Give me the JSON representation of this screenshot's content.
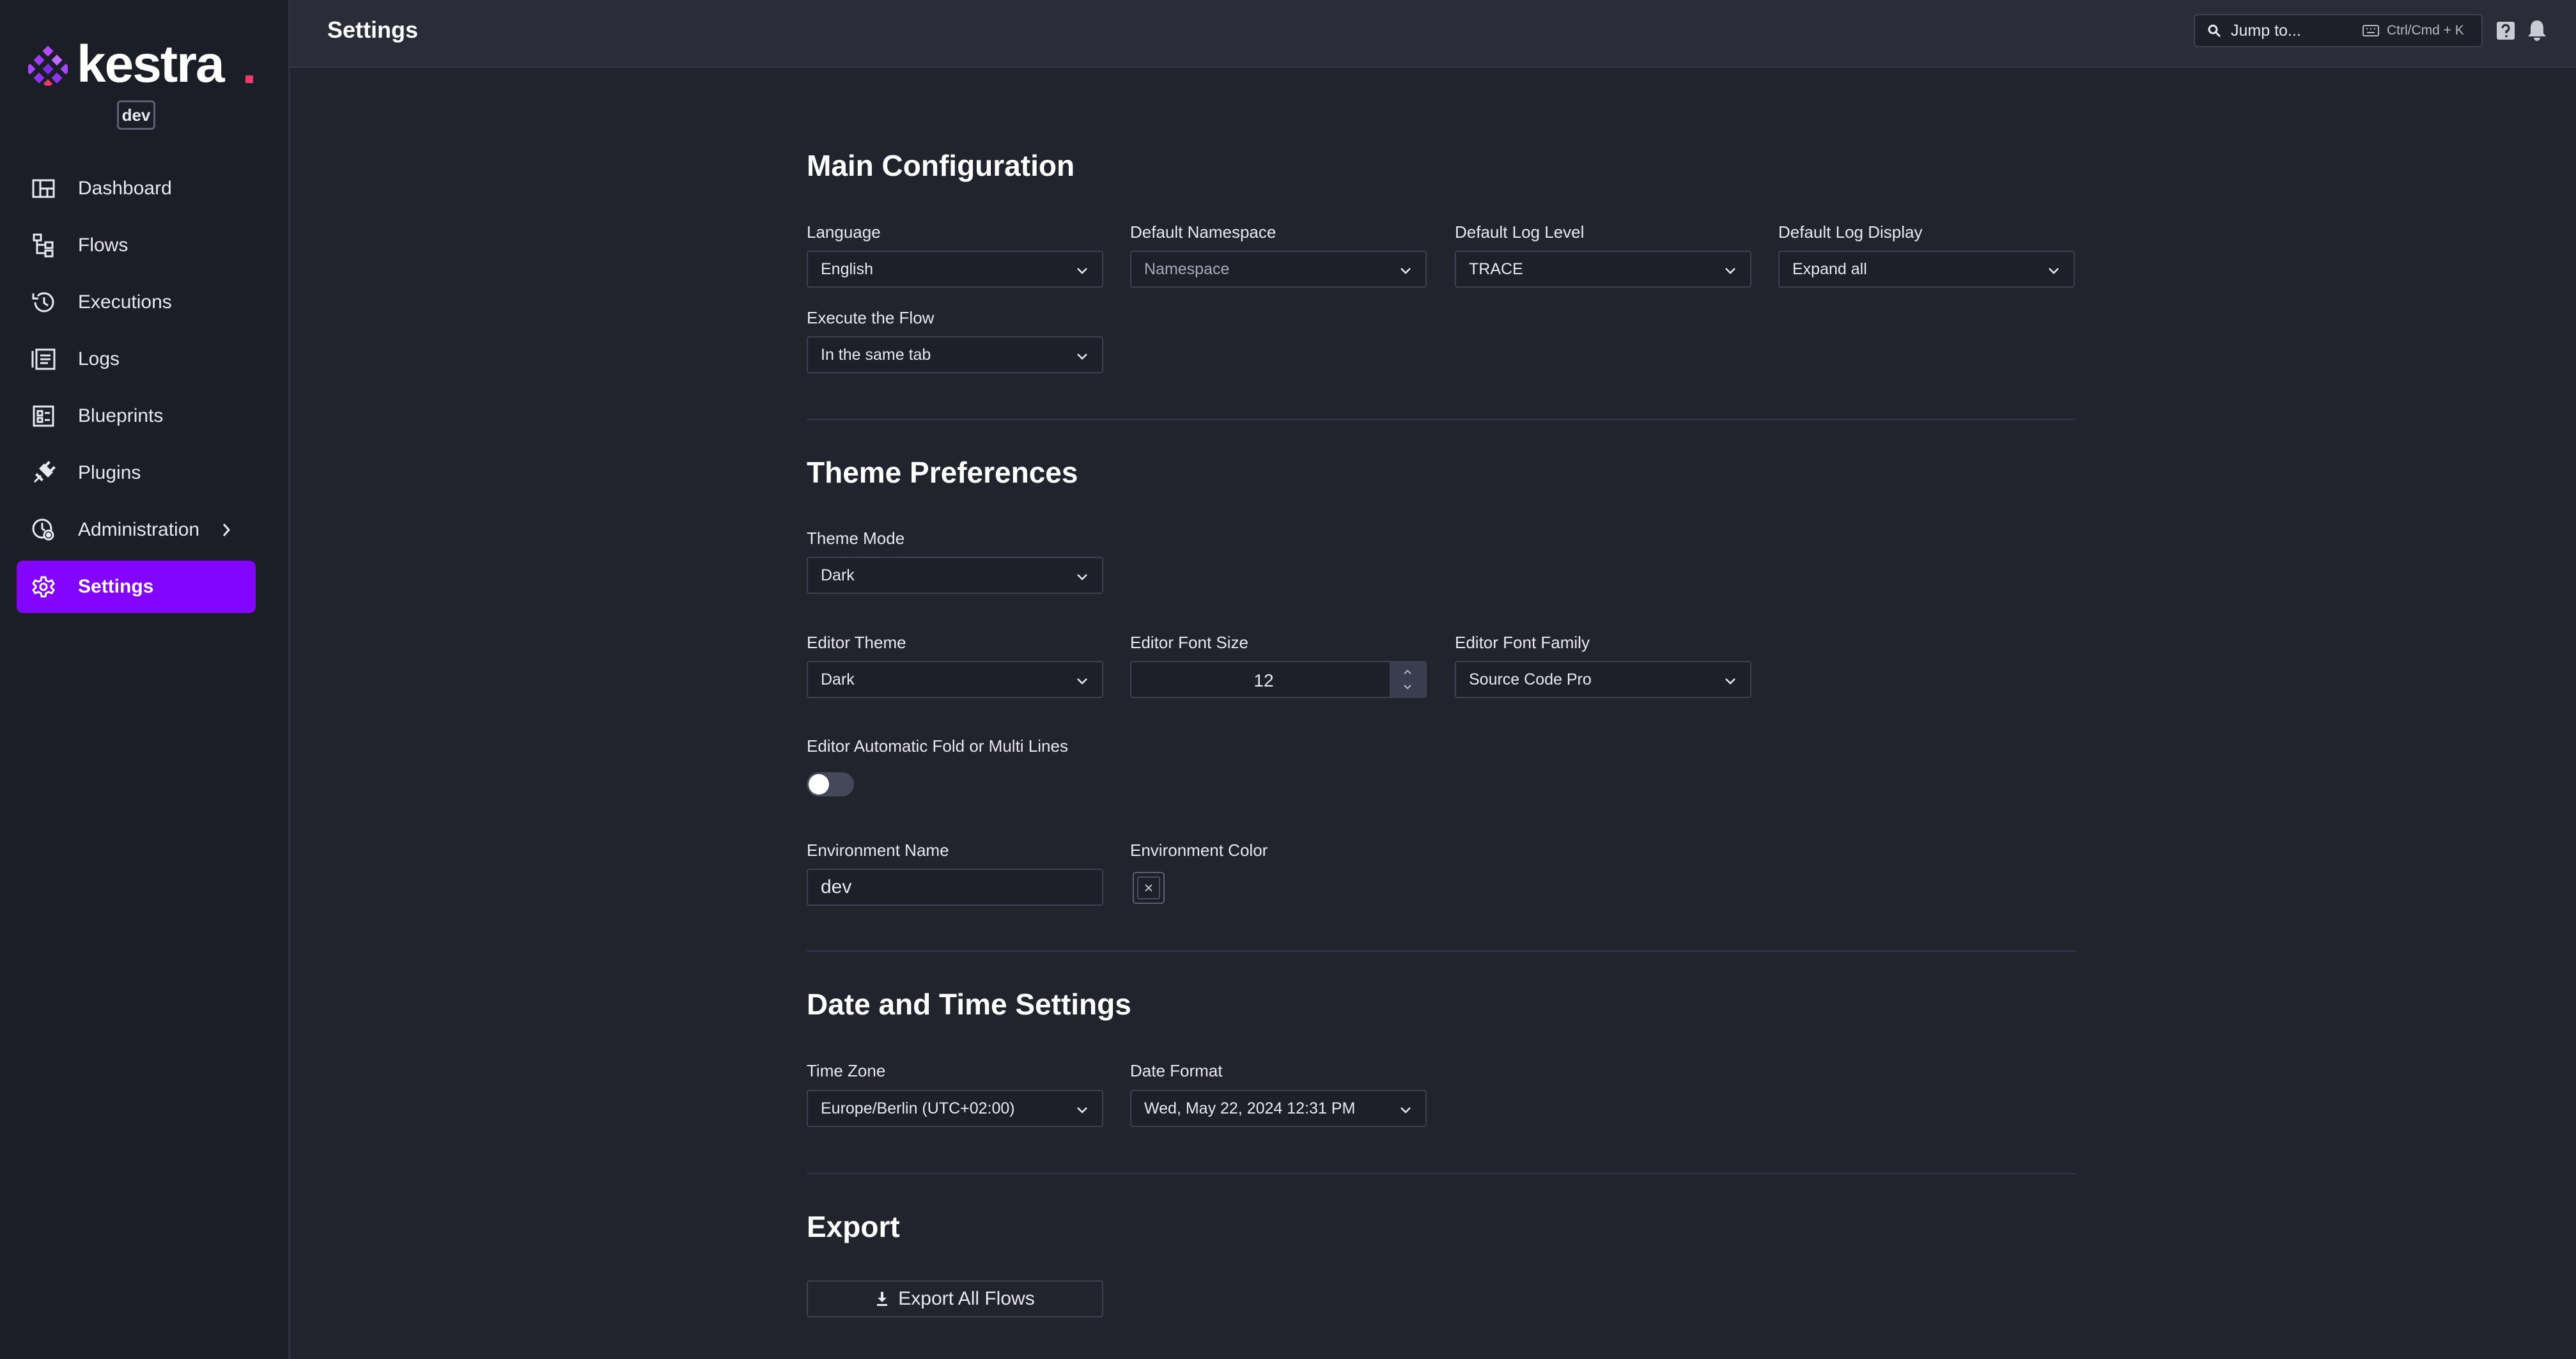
{
  "brand": {
    "name": "kestra",
    "env_badge": "dev",
    "accent": "#8405ff",
    "dot_color": "#e83a6d"
  },
  "sidebar": {
    "items": [
      {
        "label": "Dashboard",
        "icon": "dashboard-icon"
      },
      {
        "label": "Flows",
        "icon": "flows-icon"
      },
      {
        "label": "Executions",
        "icon": "executions-icon"
      },
      {
        "label": "Logs",
        "icon": "logs-icon"
      },
      {
        "label": "Blueprints",
        "icon": "blueprints-icon"
      },
      {
        "label": "Plugins",
        "icon": "plugins-icon"
      },
      {
        "label": "Administration",
        "icon": "administration-icon",
        "has_submenu": true
      },
      {
        "label": "Settings",
        "icon": "settings-icon",
        "active": true
      }
    ]
  },
  "header": {
    "title": "Settings",
    "search_text": "Jump to...",
    "search_shortcut": "Ctrl/Cmd + K"
  },
  "main_config": {
    "title": "Main Configuration",
    "language": {
      "label": "Language",
      "value": "English"
    },
    "default_namespace": {
      "label": "Default Namespace",
      "placeholder": "Namespace"
    },
    "default_log_level": {
      "label": "Default Log Level",
      "value": "TRACE"
    },
    "default_log_display": {
      "label": "Default Log Display",
      "value": "Expand all"
    },
    "execute_flow": {
      "label": "Execute the Flow",
      "value": "In the same tab"
    }
  },
  "theme": {
    "title": "Theme Preferences",
    "theme_mode": {
      "label": "Theme Mode",
      "value": "Dark"
    },
    "editor_theme": {
      "label": "Editor Theme",
      "value": "Dark"
    },
    "editor_font_size": {
      "label": "Editor Font Size",
      "value": "12"
    },
    "editor_font_family": {
      "label": "Editor Font Family",
      "value": "Source Code Pro"
    },
    "auto_fold": {
      "label": "Editor Automatic Fold or Multi Lines",
      "enabled": false
    },
    "environment_name": {
      "label": "Environment Name",
      "value": "dev"
    },
    "environment_color": {
      "label": "Environment Color",
      "value": "none"
    }
  },
  "datetime": {
    "title": "Date and Time Settings",
    "time_zone": {
      "label": "Time Zone",
      "value": "Europe/Berlin (UTC+02:00)"
    },
    "date_format": {
      "label": "Date Format",
      "value": "Wed, May 22, 2024 12:31 PM"
    }
  },
  "export": {
    "title": "Export",
    "button_label": "Export All Flows"
  }
}
